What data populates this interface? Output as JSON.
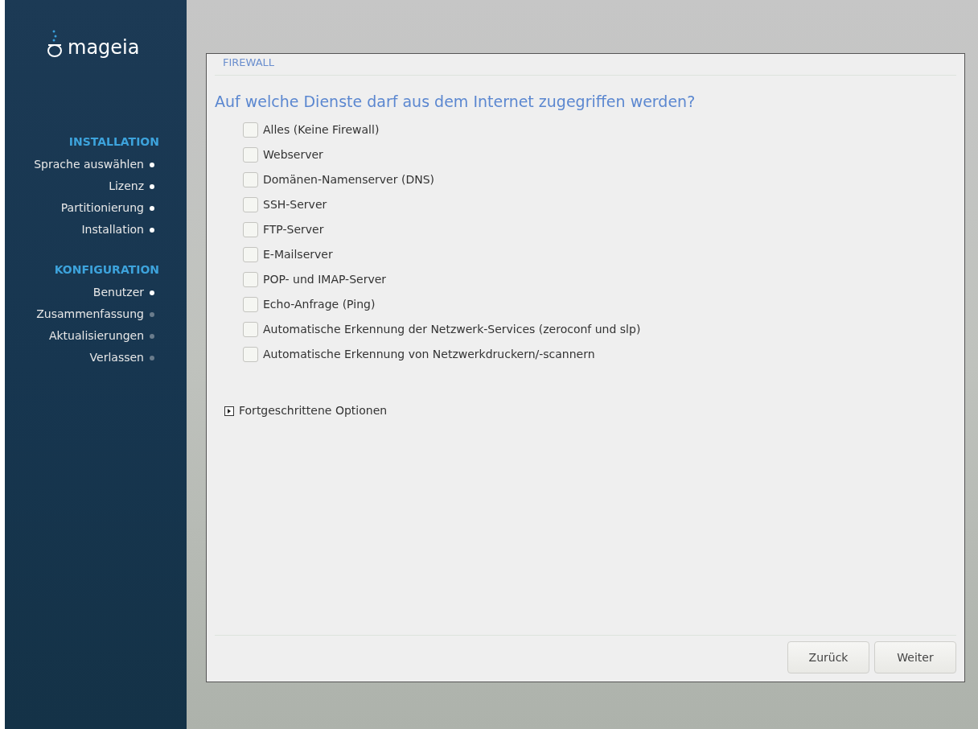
{
  "sidebar": {
    "logo": "mageia",
    "sections": [
      {
        "title": "INSTALLATION",
        "steps": [
          {
            "label": "Sprache auswählen",
            "done": true
          },
          {
            "label": "Lizenz",
            "done": true
          },
          {
            "label": "Partitionierung",
            "done": true
          },
          {
            "label": "Installation",
            "done": true
          }
        ]
      },
      {
        "title": "KONFIGURATION",
        "steps": [
          {
            "label": "Benutzer",
            "done": true
          },
          {
            "label": "Zusammenfassung",
            "done": false
          },
          {
            "label": "Aktualisierungen",
            "done": false
          },
          {
            "label": "Verlassen",
            "done": false
          }
        ]
      }
    ]
  },
  "dialog": {
    "title": "FIREWALL",
    "question": "Auf welche Dienste darf aus dem Internet zugegriffen werden?",
    "services": [
      {
        "label": "Alles (Keine Firewall)",
        "checked": false
      },
      {
        "label": "Webserver",
        "checked": false
      },
      {
        "label": "Domänen-Namenserver (DNS)",
        "checked": false
      },
      {
        "label": "SSH-Server",
        "checked": false
      },
      {
        "label": "FTP-Server",
        "checked": false
      },
      {
        "label": "E-Mailserver",
        "checked": false
      },
      {
        "label": "POP- und IMAP-Server",
        "checked": false
      },
      {
        "label": "Echo-Anfrage (Ping)",
        "checked": false
      },
      {
        "label": "Automatische Erkennung der Netzwerk-Services (zeroconf und slp)",
        "checked": false
      },
      {
        "label": "Automatische Erkennung von Netzwerkdruckern/-scannern",
        "checked": false
      }
    ],
    "advanced": {
      "label": "Fortgeschrittene Optionen",
      "expanded": false
    },
    "buttons": [
      "Zurück",
      "Weiter"
    ]
  }
}
